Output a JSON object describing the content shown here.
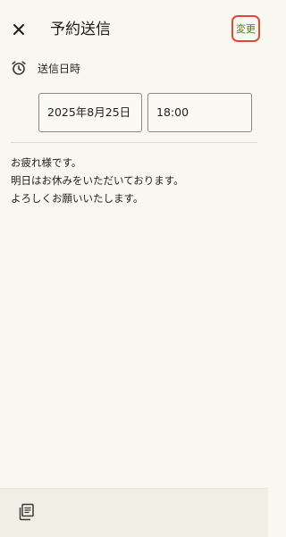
{
  "header": {
    "title": "予約送信",
    "change_label": "変更"
  },
  "schedule": {
    "label": "送信日時",
    "date": "2025年8月25日",
    "time": "18:00"
  },
  "message": {
    "lines": [
      "お疲れ様です。",
      "明日はお休みをいただいております。",
      "よろしくお願いいたします。"
    ]
  },
  "icons": {
    "close": "close-icon",
    "alarm": "alarm-icon",
    "templates": "templates-icon"
  },
  "colors": {
    "background": "#f8f7f0",
    "accent_text": "#4e7a1f",
    "highlight_border": "#e2473b",
    "bottom_bar": "#efefe5"
  }
}
